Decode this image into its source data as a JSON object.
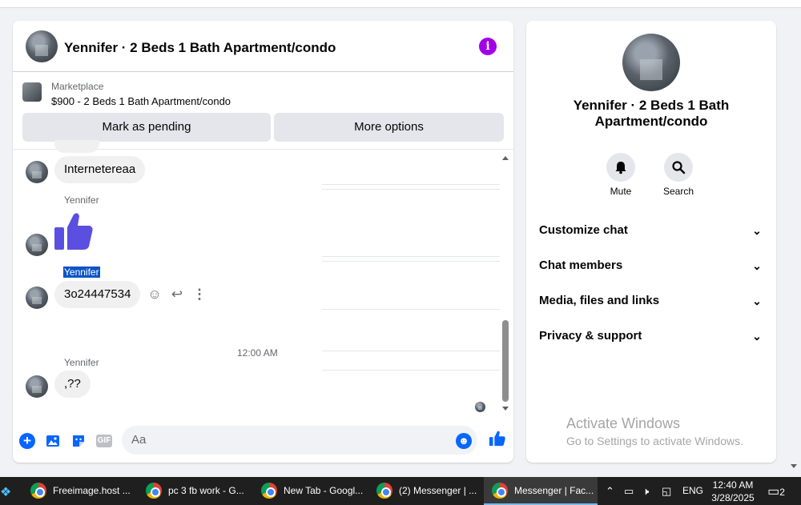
{
  "header": {
    "title": "Yennifer · 2 Beds 1 Bath Apartment/condo",
    "info_icon": "info-icon"
  },
  "marketplace": {
    "label": "Marketplace",
    "listing": "$900 - 2 Beds 1 Bath Apartment/condo",
    "mark_pending": "Mark as pending",
    "more_options": "More options"
  },
  "messages": {
    "msg1": "Internetereaa",
    "sender2": "Yennifer",
    "sender3": "Yennifer",
    "msg3": "3o24447534",
    "time_separator": "12:00 AM",
    "sender4": "Yennifer",
    "msg4": ",??"
  },
  "composer": {
    "placeholder": "Aa",
    "gif_label": "GIF"
  },
  "details": {
    "title": "Yennifer · 2 Beds 1 Bath Apartment/condo",
    "mute_label": "Mute",
    "search_label": "Search",
    "sections": [
      "Customize chat",
      "Chat members",
      "Media, files and links",
      "Privacy & support"
    ]
  },
  "watermark": {
    "line1": "Activate Windows",
    "line2": "Go to Settings to activate Windows."
  },
  "taskbar": {
    "apps": [
      "Freeimage.host ...",
      "pc 3 fb work - G...",
      "New Tab - Googl...",
      "(2) Messenger | ...",
      "Messenger | Fac..."
    ],
    "language": "ENG",
    "time": "12:40 AM",
    "date": "3/28/2025",
    "notifications": "2"
  },
  "colors": {
    "accent": "#0866ff",
    "info": "#a100e6"
  }
}
